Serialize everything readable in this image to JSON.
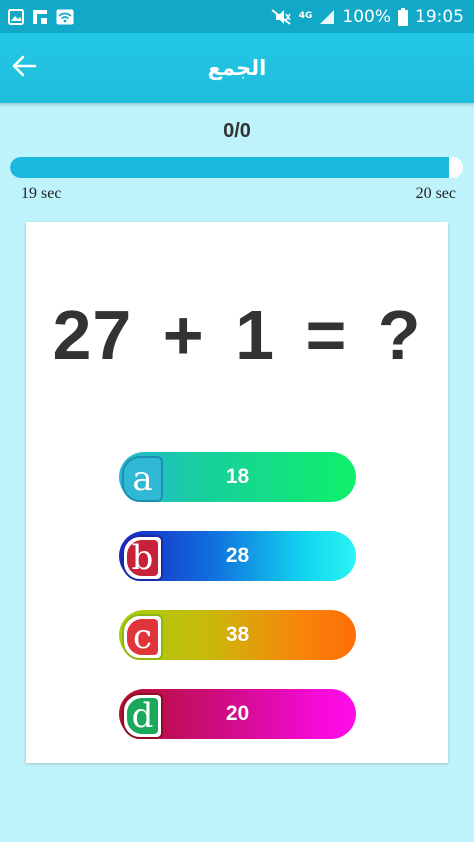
{
  "status_bar": {
    "network_label": "4G",
    "battery_text": "100%",
    "time": "19:05",
    "icons": [
      "gallery-icon",
      "flipboard-icon",
      "wifi-icon",
      "mute-icon",
      "signal-icon",
      "battery-icon"
    ]
  },
  "app_bar": {
    "title": "الجمع",
    "back_icon": "arrow-left-icon"
  },
  "game": {
    "score": "0/0",
    "timer_progress": 0.97,
    "time_remaining": "19 sec",
    "time_total": "20 sec",
    "question": "27 + 1 = ?"
  },
  "answers": [
    {
      "letter": "a",
      "value": "18"
    },
    {
      "letter": "b",
      "value": "28"
    },
    {
      "letter": "c",
      "value": "38"
    },
    {
      "letter": "d",
      "value": "20"
    }
  ],
  "colors": {
    "background": "#bff3fb",
    "app_bar": "#1fbcdb",
    "progress": "#1cb9df",
    "letter_a": "#2fb9d4",
    "letter_b": "#c8213a",
    "letter_c": "#e0353a",
    "letter_d": "#1aa85c"
  }
}
